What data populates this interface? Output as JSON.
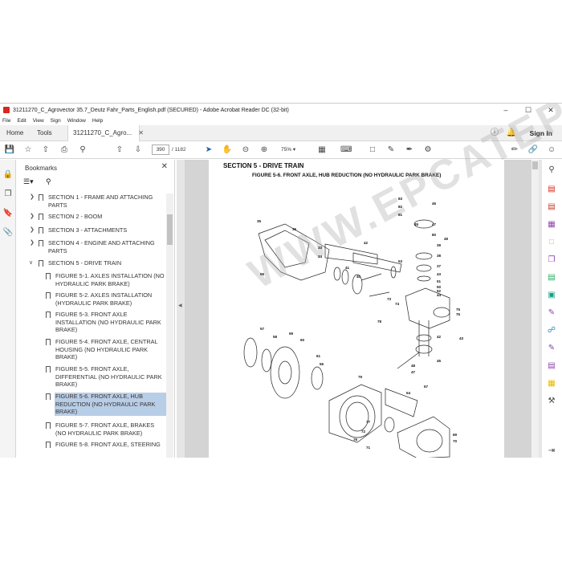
{
  "window": {
    "title": "31211270_C_Agrovector 35.7_Deutz Fahr_Parts_English.pdf (SECURED) - Adobe Acrobat Reader DC (32-bit)"
  },
  "menu": [
    "File",
    "Edit",
    "View",
    "Sign",
    "Window",
    "Help"
  ],
  "tabs": {
    "home": "Home",
    "tools": "Tools",
    "doc": "31211270_C_Agro..."
  },
  "signin": "Sign In",
  "toolbar": {
    "page_current": "390",
    "page_total": "/ 1182",
    "zoom": "75%"
  },
  "bookmarks": {
    "title": "Bookmarks",
    "items": [
      "SECTION 1 - FRAME AND ATTACHING PARTS",
      "SECTION 2 - BOOM",
      "SECTION 3 - ATTACHMENTS",
      "SECTION 4 - ENGINE AND ATTACHING PARTS",
      "SECTION 5 - DRIVE TRAIN",
      "FIGURE 5-1. AXLES INSTALLATION (NO HYDRAULIC PARK BRAKE)",
      "FIGURE 5-2. AXLES INSTALLATION (HYDRAULIC PARK BRAKE)",
      "FIGURE 5-3. FRONT AXLE INSTALLATION (NO HYDRAULIC PARK BRAKE)",
      "FIGURE 5-4. FRONT AXLE, CENTRAL HOUSING (NO HYDRAULIC PARK BRAKE)",
      "FIGURE 5-5. FRONT AXLE, DIFFERENTIAL (NO HYDRAULIC PARK BRAKE)",
      "FIGURE 5-6. FRONT AXLE, HUB REDUCTION (NO HYDRAULIC PARK BRAKE)",
      "FIGURE 5-7. FRONT AXLE, BRAKES (NO HYDRAULIC PARK BRAKE)",
      "FIGURE 5-8. FRONT AXLE, STEERING"
    ]
  },
  "page": {
    "section_title": "SECTION 5 - DRIVE TRAIN",
    "figure_title": "FIGURE 5-6. FRONT AXLE, HUB REDUCTION (NO HYDRAULIC PARK BRAKE)",
    "watermark": "WWW.EPCATEPO.COM",
    "callouts": [
      "83",
      "82",
      "81",
      "46",
      "35",
      "36",
      "47",
      "45",
      "49",
      "80",
      "39",
      "42",
      "38",
      "37",
      "53",
      "33",
      "34",
      "40",
      "51",
      "41",
      "43",
      "50",
      "52",
      "44",
      "55",
      "73",
      "74",
      "75",
      "76",
      "78",
      "57",
      "58",
      "59",
      "60",
      "61",
      "56",
      "42",
      "43",
      "48",
      "47",
      "45",
      "79",
      "54",
      "67",
      "77",
      "72",
      "76",
      "71",
      "69",
      "70"
    ]
  },
  "icons": {
    "accent": "#d8271c"
  }
}
